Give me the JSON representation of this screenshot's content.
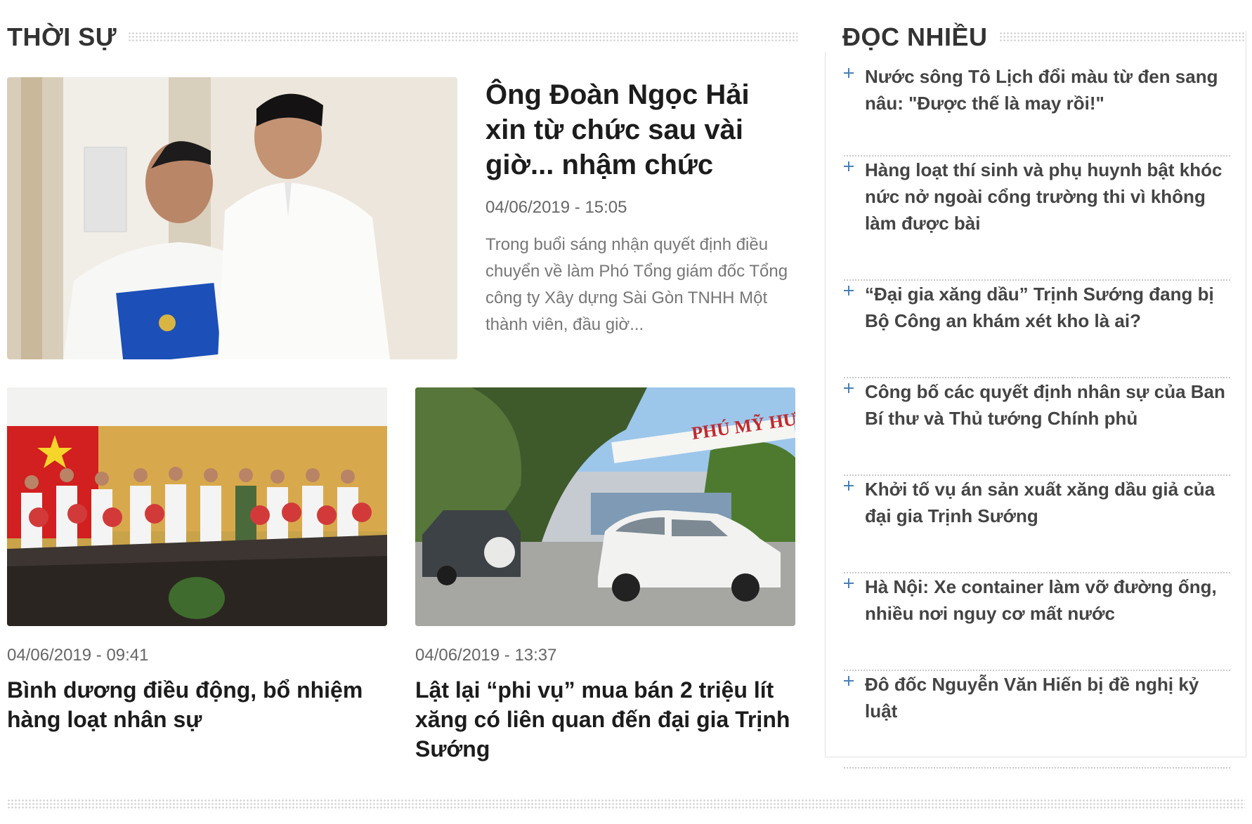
{
  "section": {
    "title": "THỜI SỰ"
  },
  "featured": {
    "title": "Ông Đoàn Ngọc Hải xin từ chức sau vài giờ... nhậm chức",
    "time": "04/06/2019 - 15:05",
    "sapo": "Trong buổi sáng nhận quyết định điều chuyển về làm Phó Tổng giám đốc Tổng công ty Xây dựng Sài Gòn TNHH Một thành viên, đầu giờ...",
    "image_icon": "photo-two-officials-icon"
  },
  "cards": [
    {
      "time": "04/06/2019 - 09:41",
      "title": "Bình dương điều động, bổ nhiệm hàng loạt nhân sự",
      "image_icon": "photo-officials-group-icon"
    },
    {
      "time": "04/06/2019 - 13:37",
      "title": "Lật lại “phi vụ” mua bán 2 triệu lít xăng có liên quan đến đại gia Trịnh Sướng",
      "image_icon": "photo-gas-depot-cars-icon",
      "sign_text": "PHÚ MỸ HƯ"
    }
  ],
  "most_read": {
    "title": "ĐỌC NHIỀU",
    "items": [
      "Nước sông Tô Lịch đổi màu từ đen sang nâu: \"Được thế là may rồi!\"",
      "Hàng loạt thí sinh và phụ huynh bật khóc nức nở ngoài cổng trường thi vì không làm được bài",
      "“Đại gia xăng dầu” Trịnh Sướng đang bị Bộ Công an khám xét kho là ai?",
      "Công bố các quyết định nhân sự của Ban Bí thư và Thủ tướng Chính phủ",
      "Khởi tố vụ án sản xuất xăng dầu giả của đại gia Trịnh Sướng",
      "Hà Nội: Xe container làm vỡ đường ống, nhiều nơi nguy cơ mất nước",
      "Đô đốc Nguyễn Văn Hiến bị đề nghị kỷ luật"
    ]
  },
  "colors": {
    "accent": "#4a7fb6",
    "title_text": "#1c1c1c",
    "meta_text": "#666666",
    "sapo_text": "#777777"
  }
}
